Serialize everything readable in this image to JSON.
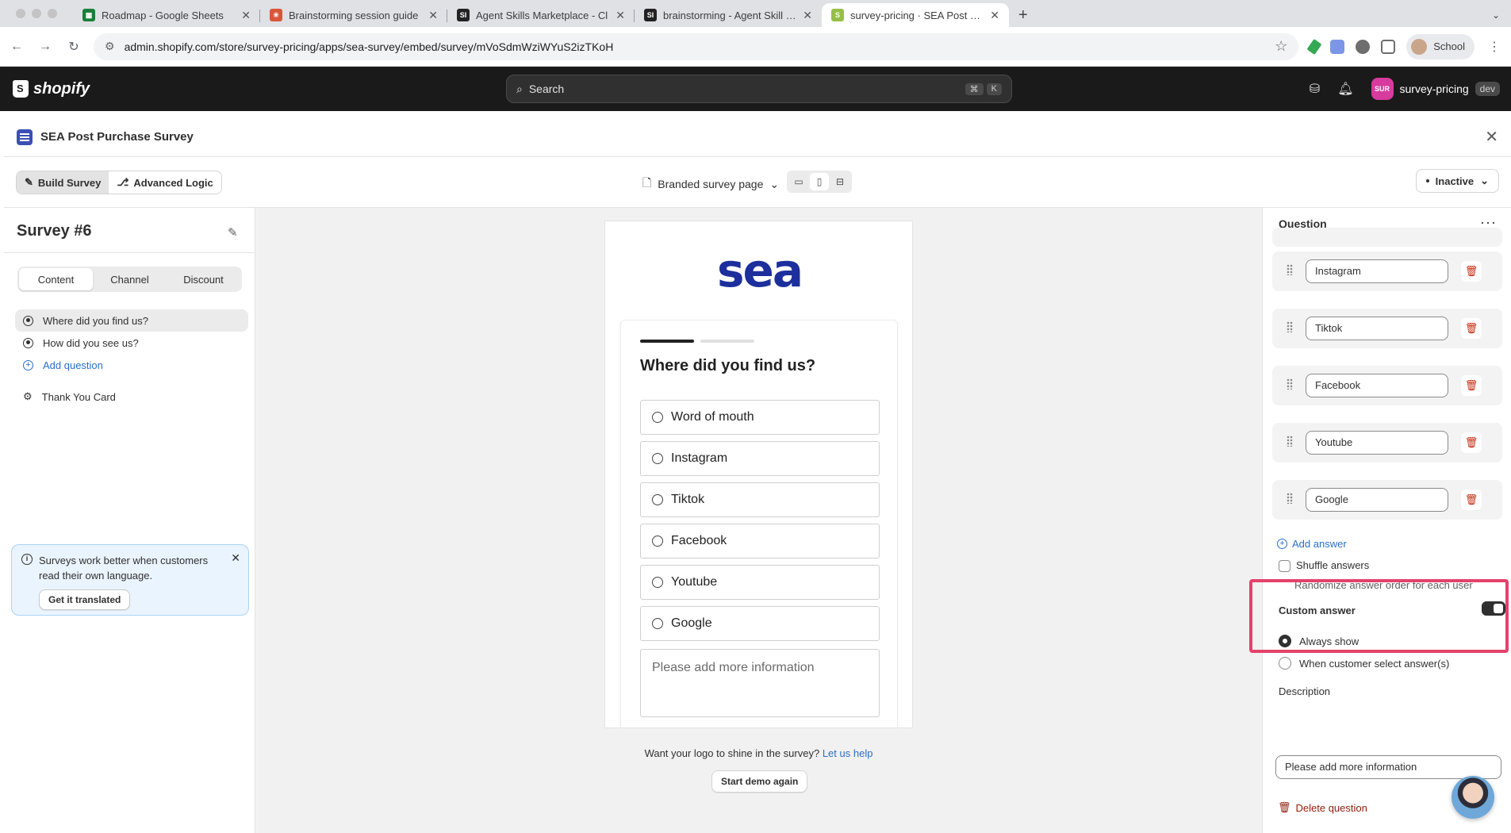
{
  "browser": {
    "tabs": [
      {
        "title": "Roadmap - Google Sheets",
        "fav_color": "#188038",
        "fav_text": "▦"
      },
      {
        "title": "Brainstorming session guide",
        "fav_color": "#d9563b",
        "fav_text": "✳"
      },
      {
        "title": "Agent Skills Marketplace - Cl",
        "fav_color": "#222222",
        "fav_text": "SI"
      },
      {
        "title": "brainstorming - Agent Skill by",
        "fav_color": "#222222",
        "fav_text": "SI"
      },
      {
        "title": "survey-pricing · SEA Post Pur",
        "fav_color": "#95bf47",
        "fav_text": "S"
      }
    ],
    "url": "admin.shopify.com/store/survey-pricing/apps/sea-survey/embed/survey/mVoSdmWziWYuS2izTKoH",
    "profile_label": "School"
  },
  "shopify": {
    "logo_text": "shopify",
    "search_placeholder": "Search",
    "kbd": [
      "⌘",
      "K"
    ],
    "store_badge": "SUR",
    "store_name": "survey-pricing",
    "store_env": "dev"
  },
  "app": {
    "title": "SEA Post Purchase Survey",
    "mode_tabs": [
      "Build Survey",
      "Advanced Logic"
    ],
    "page_selector": "Branded survey page",
    "status": "Inactive"
  },
  "left": {
    "survey_name": "Survey #6",
    "tabs": [
      "Content",
      "Channel",
      "Discount"
    ],
    "questions": [
      "Where did you find us?",
      "How did you see us?"
    ],
    "add_question": "Add question",
    "thank_you": "Thank You Card",
    "banner_text": "Surveys work better when customers read their own language.",
    "banner_button": "Get it translated"
  },
  "preview": {
    "logo": "sea",
    "question": "Where did you find us?",
    "options": [
      "Word of mouth",
      "Instagram",
      "Tiktok",
      "Facebook",
      "Youtube",
      "Google"
    ],
    "more_info_placeholder": "Please add more information",
    "progress": {
      "current": 1,
      "total": 2
    },
    "logo_prompt": "Want your logo to shine in the survey?",
    "logo_link": "Let us help",
    "demo_button": "Start demo again"
  },
  "right": {
    "heading": "Question",
    "answers": [
      "Instagram",
      "Tiktok",
      "Facebook",
      "Youtube",
      "Google"
    ],
    "add_answer": "Add answer",
    "shuffle_label": "Shuffle answers",
    "shuffle_help": "Randomize answer order for each user",
    "shuffle_checked": false,
    "custom_answer_label": "Custom answer",
    "custom_answer_enabled": true,
    "visibility_options": [
      "Always show",
      "When customer select answer(s)"
    ],
    "visibility_selected": "Always show",
    "description_label": "Description",
    "description_value": "Please add more information",
    "delete_question": "Delete question"
  },
  "colors": {
    "brand_blue": "#1c2f9c",
    "link_blue": "#2c6ecb",
    "highlight": "#e3426c",
    "danger": "#8e1f0b"
  }
}
